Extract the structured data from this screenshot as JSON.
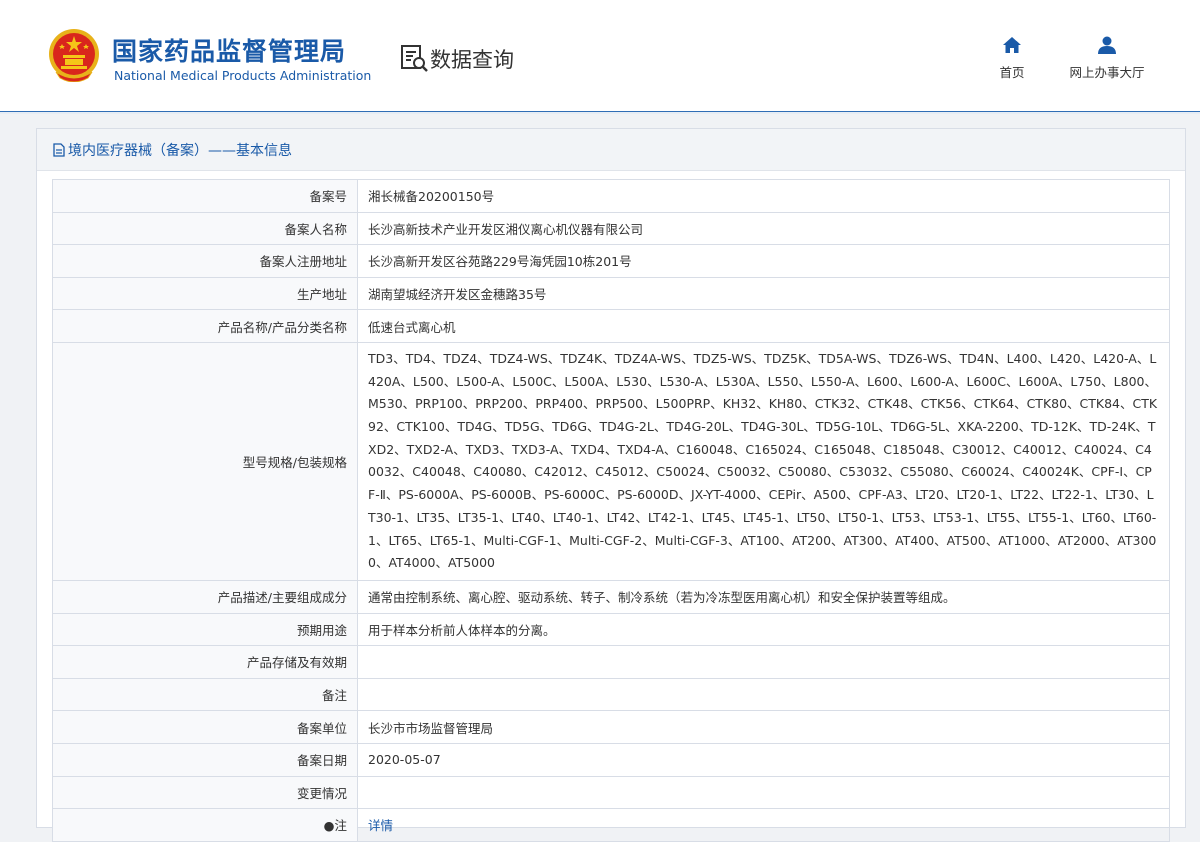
{
  "header": {
    "title_cn": "国家药品监督管理局",
    "title_en": "National Medical Products Administration",
    "query_title": "数据查询",
    "query_icon": "search-document-icon",
    "emblem_icon": "national-emblem-icon",
    "nav": [
      {
        "label": "首页",
        "icon": "home-icon"
      },
      {
        "label": "网上办事大厅",
        "icon": "user-icon"
      }
    ]
  },
  "panel": {
    "title": "境内医疗器械（备案）——基本信息",
    "title_icon": "document-icon"
  },
  "record": {
    "rows": [
      {
        "label": "备案号",
        "value": "湘长械备20200150号"
      },
      {
        "label": "备案人名称",
        "value": "长沙高新技术产业开发区湘仪离心机仪器有限公司"
      },
      {
        "label": "备案人注册地址",
        "value": "长沙高新开发区谷苑路229号海凭园10栋201号"
      },
      {
        "label": "生产地址",
        "value": "湖南望城经济开发区金穗路35号"
      },
      {
        "label": "产品名称/产品分类名称",
        "value": "低速台式离心机"
      },
      {
        "label": "型号规格/包装规格",
        "value": "TD3、TD4、TDZ4、TDZ4-WS、TDZ4K、TDZ4A-WS、TDZ5-WS、TDZ5K、TD5A-WS、TDZ6-WS、TD4N、L400、L420、L420-A、L420A、L500、L500-A、L500C、L500A、L530、L530-A、L530A、L550、L550-A、L600、L600-A、L600C、L600A、L750、L800、M530、PRP100、PRP200、PRP400、PRP500、L500PRP、KH32、KH80、CTK32、CTK48、CTK56、CTK64、CTK80、CTK84、CTK92、CTK100、TD4G、TD5G、TD6G、TD4G-2L、TD4G-20L、TD4G-30L、TD5G-10L、TD6G-5L、XKA-2200、TD-12K、TD-24K、TXD2、TXD2-A、TXD3、TXD3-A、TXD4、TXD4-A、C160048、C165024、C165048、C185048、C30012、C40012、C40024、C40032、C40048、C40080、C42012、C45012、C50024、C50032、C50080、C53032、C55080、C60024、C40024K、CPF-Ⅰ、CPF-Ⅱ、PS-6000A、PS-6000B、PS-6000C、PS-6000D、JX-YT-4000、CEPir、A500、CPF-A3、LT20、LT20-1、LT22、LT22-1、LT30、LT30-1、LT35、LT35-1、LT40、LT40-1、LT42、LT42-1、LT45、LT45-1、LT50、LT50-1、LT53、LT53-1、LT55、LT55-1、LT60、LT60-1、LT65、LT65-1、Multi-CGF-1、Multi-CGF-2、Multi-CGF-3、AT100、AT200、AT300、AT400、AT500、AT1000、AT2000、AT3000、AT4000、AT5000"
      },
      {
        "label": "产品描述/主要组成成分",
        "value": "通常由控制系统、离心腔、驱动系统、转子、制冷系统（若为冷冻型医用离心机）和安全保护装置等组成。"
      },
      {
        "label": "预期用途",
        "value": "用于样本分析前人体样本的分离。"
      },
      {
        "label": "产品存储及有效期",
        "value": ""
      },
      {
        "label": "备注",
        "value": ""
      },
      {
        "label": "备案单位",
        "value": "长沙市市场监督管理局"
      },
      {
        "label": "备案日期",
        "value": "2020-05-07"
      },
      {
        "label": "变更情况",
        "value": ""
      },
      {
        "label": "●注",
        "value": "详情"
      }
    ]
  },
  "colors": {
    "brand_blue": "#1a5aa8",
    "emblem_red": "#d9261c",
    "emblem_gold": "#f5c518"
  }
}
